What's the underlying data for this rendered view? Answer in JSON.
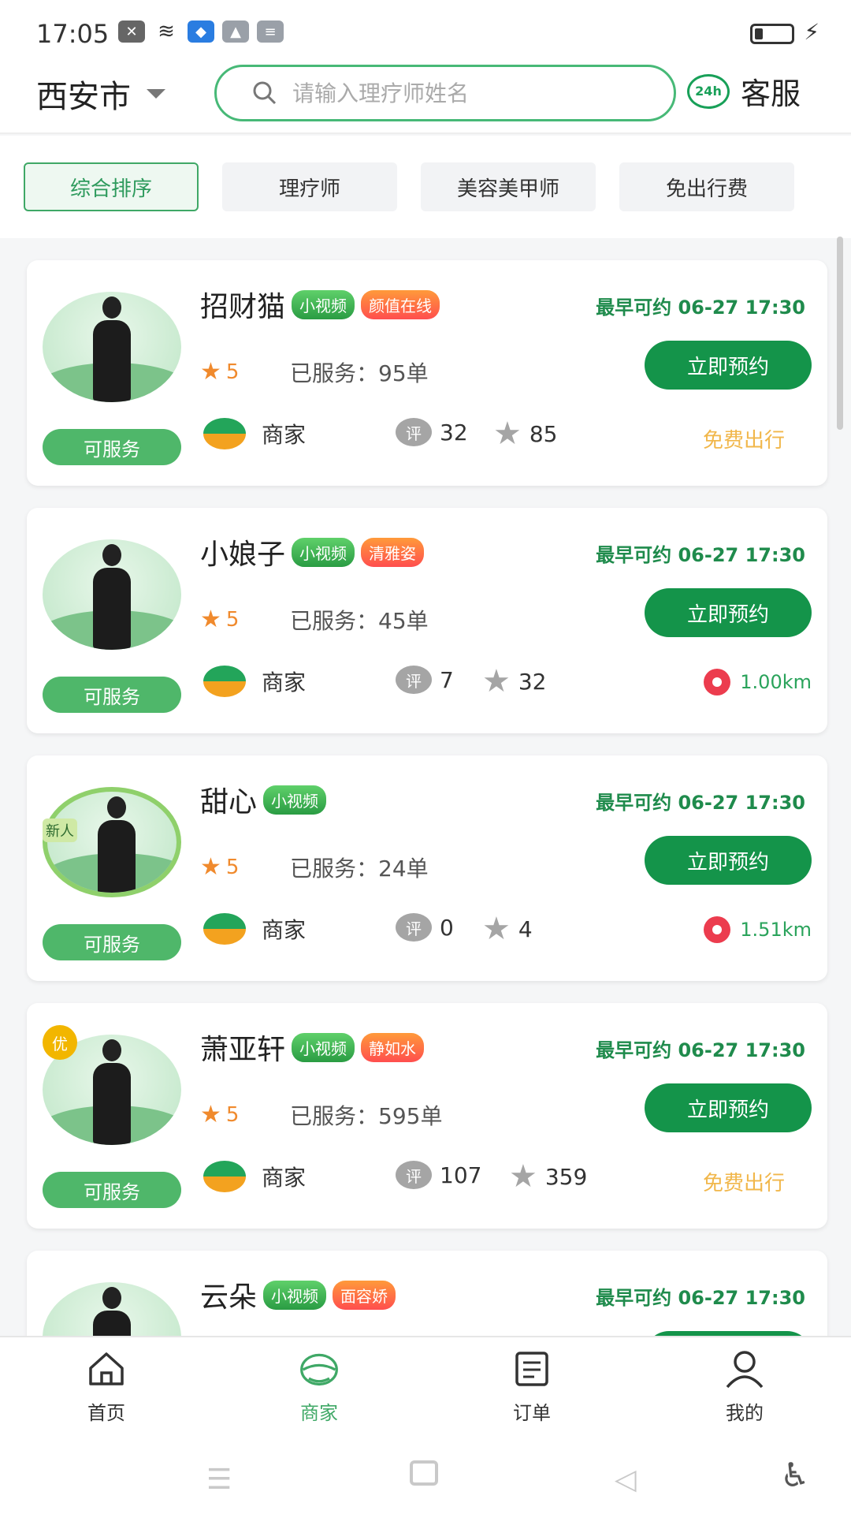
{
  "status_bar": {
    "time": "17:05"
  },
  "header": {
    "city": "西安市",
    "search_placeholder": "请输入理疗师姓名",
    "service_badge": "24h",
    "service_label": "客服"
  },
  "filters": [
    "综合排序",
    "理疗师",
    "美容美甲师",
    "免出行费"
  ],
  "cards": [
    {
      "name": "招财猫",
      "tags": [
        "小视频",
        "颜值在线"
      ],
      "status": "可服务",
      "earliest": "最早可约 06-27 17:30",
      "book": "立即预约",
      "rating": "5",
      "served": "已服务：95单",
      "merchant": "商家",
      "review_badge": "评",
      "reviews": "32",
      "fav_badge": "藏",
      "favs": "85",
      "extra": "免费出行"
    },
    {
      "name": "小娘子",
      "tags": [
        "小视频",
        "清雅姿"
      ],
      "status": "可服务",
      "earliest": "最早可约 06-27 17:30",
      "book": "立即预约",
      "rating": "5",
      "served": "已服务：45单",
      "merchant": "商家",
      "review_badge": "评",
      "reviews": "7",
      "fav_badge": "藏",
      "favs": "32",
      "extra": "1.00km"
    },
    {
      "name": "甜心",
      "tags": [
        "小视频"
      ],
      "badge": "新人",
      "status": "可服务",
      "earliest": "最早可约 06-27 17:30",
      "book": "立即预约",
      "rating": "5",
      "served": "已服务：24单",
      "merchant": "商家",
      "review_badge": "评",
      "reviews": "0",
      "fav_badge": "藏",
      "favs": "4",
      "extra": "1.51km"
    },
    {
      "name": "萧亚轩",
      "tags": [
        "小视频",
        "静如水"
      ],
      "medal": "优",
      "status": "可服务",
      "earliest": "最早可约 06-27 17:30",
      "book": "立即预约",
      "rating": "5",
      "served": "已服务：595单",
      "merchant": "商家",
      "review_badge": "评",
      "reviews": "107",
      "fav_badge": "藏",
      "favs": "359",
      "extra": "免费出行"
    },
    {
      "name": "云朵",
      "tags": [
        "小视频",
        "面容娇"
      ],
      "earliest": "最早可约 06-27 17:30"
    }
  ],
  "tabbar": [
    {
      "label": "首页",
      "icon": "home-icon"
    },
    {
      "label": "商家",
      "icon": "merchant-icon"
    },
    {
      "label": "订单",
      "icon": "order-icon"
    },
    {
      "label": "我的",
      "icon": "profile-icon"
    }
  ],
  "colors": {
    "brand": "#14944a",
    "accent": "#3fa866",
    "free": "#f1b74b",
    "rating": "#f08a2d"
  }
}
